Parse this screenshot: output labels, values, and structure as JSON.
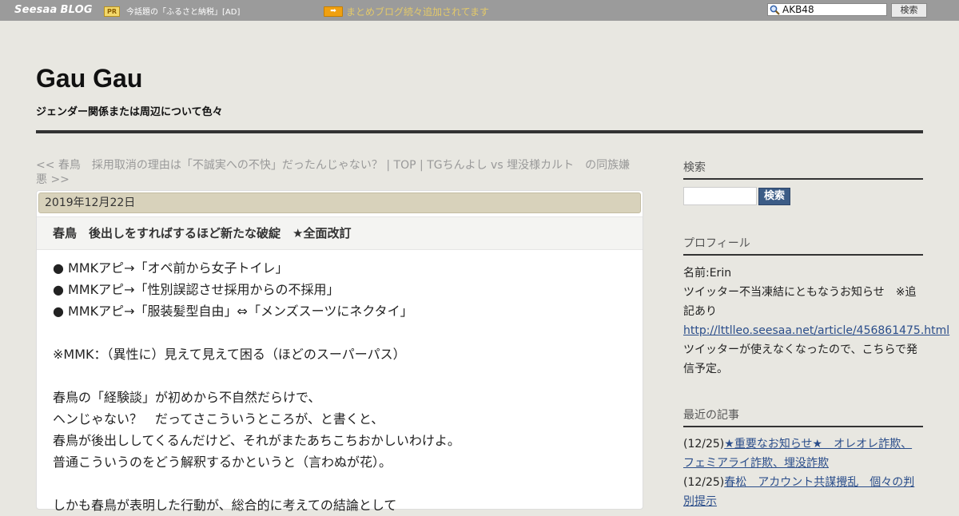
{
  "topbar": {
    "logo_seesaa": "Seesaa",
    "logo_blog": "BLOG",
    "pr_badge": "PR",
    "pr_text": "今話題の「ふるさと納税」[AD]",
    "arrow_glyph": "➡",
    "news_text": "まとめブログ続々追加されてます",
    "search_value": "AKB48",
    "search_button": "検索"
  },
  "header": {
    "title": "Gau Gau",
    "description": "ジェンダー関係または周辺について色々"
  },
  "pager": {
    "prev": "<< 春鳥　採用取消の理由は「不誠実への不快」だったんじゃない？",
    "sep1": " | ",
    "top": "TOP",
    "sep2": " | ",
    "next": "TGちんよし vs 埋没様カルト　の同族嫌悪 >>"
  },
  "article": {
    "date": "2019年12月22日",
    "title": "春鳥　後出しをすればするほど新たな破綻　★全面改訂",
    "lines": [
      "● MMKアピ→「オペ前から女子トイレ」",
      "● MMKアピ→「性別誤認させ採用からの不採用」",
      "● MMKアピ→「服装髪型自由」⇔「メンズスーツにネクタイ」",
      "",
      "※MMK：（異性に）見えて見えて困る（ほどのスーパーパス）",
      "",
      "春鳥の「経験談」が初めから不自然だらけで、",
      "ヘンじゃない？　だってさこういうところが、と書くと、",
      "春鳥が後出ししてくるんだけど、それがまたあちこちおかしいわけよ。",
      "普通こういうのをどう解釈するかというと（言わぬが花）。",
      "",
      "しかも春鳥が表明した行動が、総合的に考えての結論として"
    ]
  },
  "sidebar": {
    "search_heading": "検索",
    "search_button": "検索",
    "profile_heading": "プロフィール",
    "profile_name": "名前:Erin",
    "profile_notice": "ツイッター不当凍結にともなうお知らせ　※追記あり",
    "profile_link": "http://lttlleo.seesaa.net/article/456861475.html",
    "profile_note": "ツイッターが使えなくなったので、こちらで発信予定。",
    "recent_heading": "最近の記事",
    "recent": [
      {
        "date": "(12/25)",
        "title": "★重要なお知らせ★　オレオレ詐欺、フェミアライ詐欺、埋没詐欺"
      },
      {
        "date": "(12/25)",
        "title": "春松　アカウント共謀攪乱　個々の判別提示"
      }
    ]
  }
}
